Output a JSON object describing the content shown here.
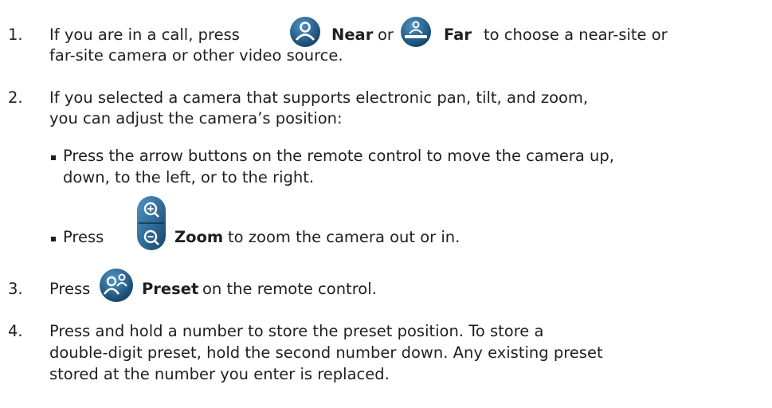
{
  "steps": [
    {
      "number": "1.",
      "line1_pre": "If you are in a call, press",
      "near_label": "Near",
      "or_text": "or",
      "far_label": "Far",
      "line1_post": "to choose a near-site or",
      "line2": "far-site camera or other video source."
    },
    {
      "number": "2.",
      "line1": "If you selected a camera that supports electronic pan, tilt, and zoom,",
      "line2": "you can adjust the camera’s position:",
      "bullets": [
        {
          "line1": "Press the arrow buttons on the remote control to move the camera up,",
          "line2": "down, to the left, or to the right."
        },
        {
          "pre": "Press",
          "zoom_label": "Zoom",
          "post": "to zoom the camera out or in."
        }
      ]
    },
    {
      "number": "3.",
      "pre": "Press",
      "preset_label": "Preset",
      "post": "on the remote control."
    },
    {
      "number": "4.",
      "line1": "Press and hold a number to store the preset position. To store a",
      "line2": "double-digit preset, hold the second number down. Any existing preset",
      "line3": "stored at the number you enter is replaced."
    }
  ],
  "icons": {
    "near": "near-camera-icon",
    "far": "far-camera-icon",
    "zoom": "zoom-icon",
    "preset": "preset-icon",
    "icon_color": "#1e5a86"
  }
}
